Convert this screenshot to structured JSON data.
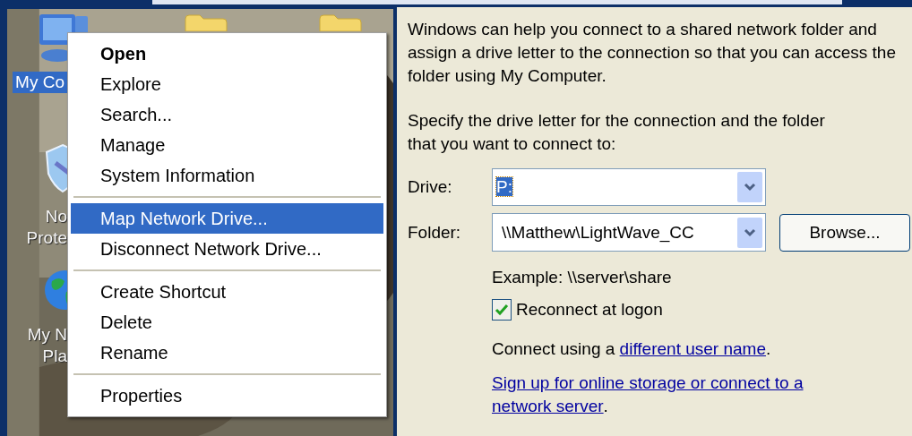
{
  "desktop": {
    "icons": [
      {
        "kind": "computer",
        "lines": [
          "My Co"
        ],
        "selected": true
      },
      {
        "kind": "shield",
        "lines": [
          "No",
          "Prote"
        ],
        "selected": false
      },
      {
        "kind": "globe",
        "lines": [
          "My N",
          "Pla"
        ],
        "selected": false
      }
    ]
  },
  "context_menu": {
    "groups": [
      [
        {
          "label": "Open",
          "default": true,
          "selected": false
        },
        {
          "label": "Explore",
          "default": false,
          "selected": false
        },
        {
          "label": "Search...",
          "default": false,
          "selected": false
        },
        {
          "label": "Manage",
          "default": false,
          "selected": false
        },
        {
          "label": "System Information",
          "default": false,
          "selected": false
        }
      ],
      [
        {
          "label": "Map Network Drive...",
          "default": false,
          "selected": true
        },
        {
          "label": "Disconnect Network Drive...",
          "default": false,
          "selected": false
        }
      ],
      [
        {
          "label": "Create Shortcut",
          "default": false,
          "selected": false
        },
        {
          "label": "Delete",
          "default": false,
          "selected": false
        },
        {
          "label": "Rename",
          "default": false,
          "selected": false
        }
      ],
      [
        {
          "label": "Properties",
          "default": false,
          "selected": false
        }
      ]
    ]
  },
  "dialog": {
    "intro": "Windows can help you connect to a shared network folder and assign a drive letter to the connection so that you can access the folder using My Computer.",
    "instruction": "Specify the drive letter for the connection and the folder that you want to connect to:",
    "drive": {
      "label": "Drive:",
      "value": "P:",
      "highlighted": true
    },
    "folder": {
      "label": "Folder:",
      "value": "\\\\Matthew\\LightWave_CC",
      "highlighted": false
    },
    "browse_button": "Browse...",
    "example": "Example: \\\\server\\share",
    "reconnect": {
      "label": "Reconnect at logon",
      "checked": true
    },
    "connect": {
      "prefix": "Connect using a",
      "link": "different user name",
      "suffix": "."
    },
    "signup": {
      "link_lines": [
        "Sign up for online storage or connect to a",
        "network server"
      ],
      "suffix": "."
    }
  }
}
